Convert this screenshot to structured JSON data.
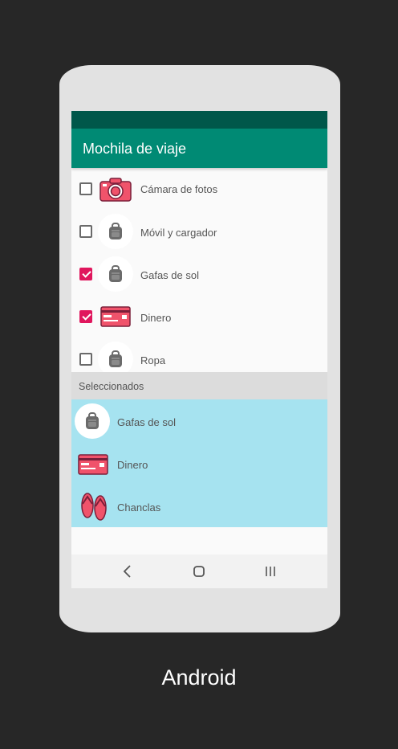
{
  "app": {
    "title": "Mochila de viaje",
    "colors": {
      "primary": "#008a74",
      "primary_dark": "#00574a",
      "accent": "#e0165d",
      "selected_bg": "#a6e3f0"
    }
  },
  "items": [
    {
      "label": "Cámara de fotos",
      "checked": false,
      "icon": "camera-icon"
    },
    {
      "label": "Móvil y cargador",
      "checked": false,
      "icon": "backpack-icon"
    },
    {
      "label": "Gafas de sol",
      "checked": true,
      "icon": "backpack-icon"
    },
    {
      "label": "Dinero",
      "checked": true,
      "icon": "credit-card-icon"
    },
    {
      "label": "Ropa",
      "checked": false,
      "icon": "backpack-icon"
    }
  ],
  "section": {
    "label": "Seleccionados"
  },
  "selected": [
    {
      "label": "Gafas de sol",
      "icon": "backpack-icon"
    },
    {
      "label": "Dinero",
      "icon": "credit-card-icon"
    },
    {
      "label": "Chanclas",
      "icon": "flip-flops-icon"
    }
  ],
  "nav": {
    "back_icon": "back-icon",
    "home_icon": "home-icon",
    "recents_icon": "recents-icon"
  },
  "caption": "Android"
}
